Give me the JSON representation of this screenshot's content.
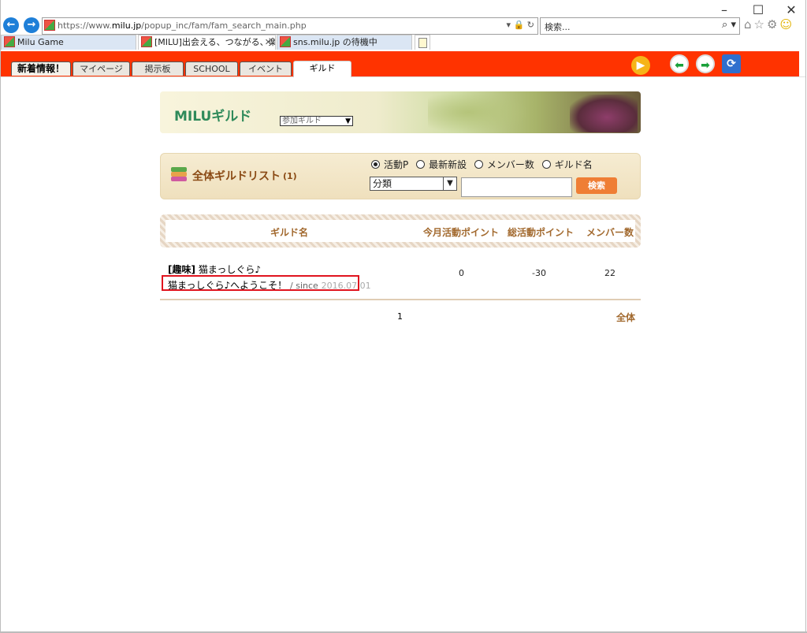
{
  "browser": {
    "url_prefix": "https://www.",
    "url_domain": "milu.jp",
    "url_path": "/popup_inc/fam/fam_search_main.php",
    "search_placeholder": "検索...",
    "tabs": [
      {
        "label": "Milu Game"
      },
      {
        "label": "[MILU]出会える、つながる、楽し..."
      },
      {
        "label": "sns.milu.jp の待機中"
      }
    ]
  },
  "site_tabs": [
    "新着情報！",
    "マイページ",
    "掲示板",
    "SCHOOL",
    "イベント",
    "ギルド"
  ],
  "banner": {
    "title": "MILUギルド",
    "select_value": "参加ギルド"
  },
  "list": {
    "title": "全体ギルドリスト",
    "count": "(1)",
    "radios": [
      "活動P",
      "最新新設",
      "メンバー数",
      "ギルド名"
    ],
    "selected_radio": 0,
    "category_value": "分類",
    "search_button": "検索"
  },
  "table": {
    "headers": [
      "ギルド名",
      "今月活動ポイント",
      "総活動ポイント",
      "メンバー数"
    ],
    "rows": [
      {
        "category": "[趣味]",
        "name": "猫まっしぐら♪",
        "welcome": "猫まっしぐら♪へようこそ！",
        "since_label": "/ since",
        "since_date": "2016.07.01",
        "monthly_points": "0",
        "total_points": "-30",
        "members": "22"
      }
    ]
  },
  "pager": {
    "page": "1",
    "all_label": "全体"
  }
}
